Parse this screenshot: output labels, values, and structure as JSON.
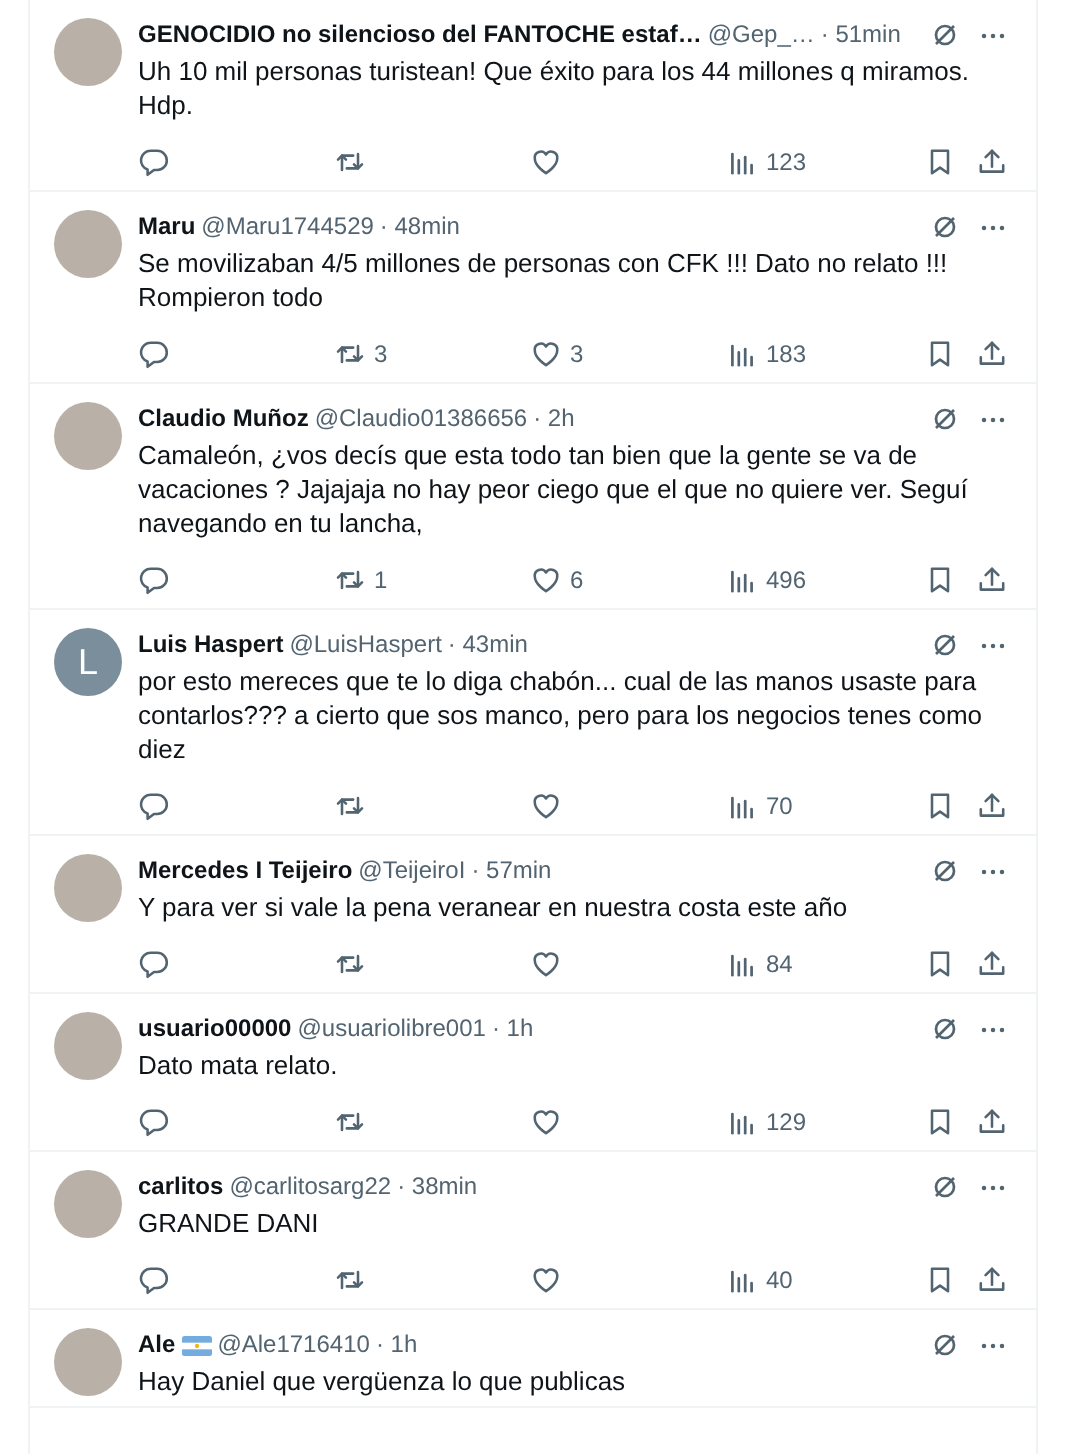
{
  "replies": [
    {
      "avatar": {
        "kind": "photo"
      },
      "name": "GENOCIDIO no silencioso del FANTOCHE estaf…",
      "handle": "@Gep_…",
      "time": "· 51min",
      "text": "Uh 10 mil personas turistean! Que éxito para los 44 millones q miramos. Hdp.",
      "views": "123"
    },
    {
      "avatar": {
        "kind": "photo"
      },
      "name": "Maru",
      "handle": "@Maru1744529",
      "time": "· 48min",
      "text": "Se movilizaban 4/5 millones de personas con CFK !!! Dato no relato !!! Rompieron todo",
      "retweets": "3",
      "likes": "3",
      "views": "183"
    },
    {
      "avatar": {
        "kind": "photo"
      },
      "name": "Claudio Muñoz",
      "handle": "@Claudio01386656",
      "time": "· 2h",
      "text": "Camaleón, ¿vos decís que esta todo tan bien que la gente se va de vacaciones ? Jajajaja no hay peor ciego que el que no quiere ver. Seguí navegando en tu lancha,",
      "retweets": "1",
      "likes": "6",
      "views": "496"
    },
    {
      "avatar": {
        "kind": "letter",
        "letter": "L"
      },
      "name": "Luis Haspert",
      "handle": "@LuisHaspert",
      "time": "· 43min",
      "text": "por esto mereces que te lo diga chabón... cual de las manos usaste para contarlos??? a cierto que sos manco, pero para los negocios tenes como diez",
      "views": "70"
    },
    {
      "avatar": {
        "kind": "photo"
      },
      "name": "Mercedes I Teijeiro",
      "handle": "@TeijeiroI",
      "time": "· 57min",
      "text": "Y para ver si vale la pena veranear en nuestra costa este año",
      "views": "84"
    },
    {
      "avatar": {
        "kind": "photo"
      },
      "name": "usuario00000",
      "handle": "@usuariolibre001",
      "time": "· 1h",
      "text": "Dato mata relato.",
      "views": "129"
    },
    {
      "avatar": {
        "kind": "photo"
      },
      "name": "carlitos",
      "handle": "@carlitosarg22",
      "time": "· 38min",
      "text": "GRANDE DANI",
      "views": "40"
    },
    {
      "avatar": {
        "kind": "photo"
      },
      "name": "Ale",
      "flag_badge": true,
      "handle": "@Ale1716410",
      "time": "· 1h",
      "text": "Hay Daniel que vergüenza lo que publicas"
    }
  ]
}
